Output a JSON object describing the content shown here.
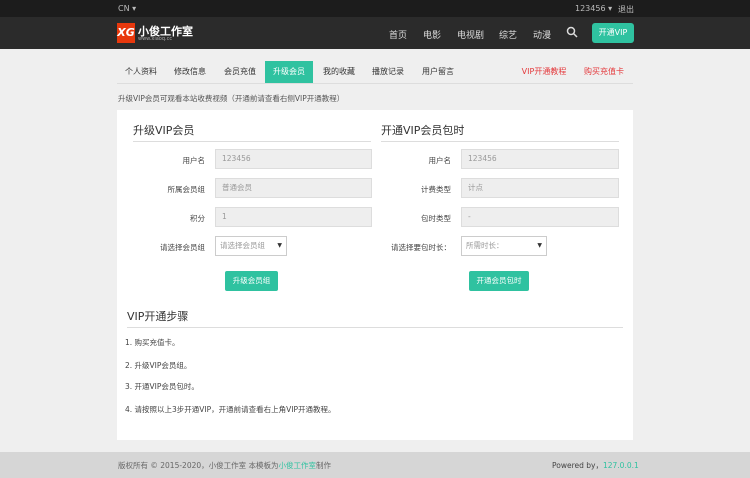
{
  "topbar": {
    "lang": "CN ▾",
    "user": "123456 ▾",
    "logout": "退出"
  },
  "logo": {
    "mark": "XG",
    "name": "小俊工作室",
    "url": "www.xiaoq.cc"
  },
  "nav": {
    "items": [
      "首页",
      "电影",
      "电视剧",
      "综艺",
      "动漫"
    ],
    "vip_button": "开通VIP"
  },
  "tabs": [
    "个人资料",
    "修改信息",
    "会员充值",
    "升级会员",
    "我的收藏",
    "播放记录",
    "用户留言"
  ],
  "tabs_right": [
    "VIP开通教程",
    "购买充值卡"
  ],
  "notice": "升级VIP会员可观看本站收费视频（开通前请查看右侧VIP开通教程）",
  "upgrade": {
    "title": "升级VIP会员",
    "username_label": "用户名",
    "username_value": "123456",
    "group_label": "所属会员组",
    "group_value": "普通会员",
    "points_label": "积分",
    "points_value": "1",
    "select_label": "请选择会员组",
    "select_value": "请选择会员组",
    "button": "升级会员组"
  },
  "package": {
    "title": "开通VIP会员包时",
    "username_label": "用户名",
    "username_value": "123456",
    "billing_label": "计费类型",
    "billing_value": "计点",
    "period_label": "包时类型",
    "period_value": "-",
    "select_label": "请选择要包时长：",
    "select_value": "所需时长：",
    "button": "开通会员包时"
  },
  "steps": {
    "title": "VIP开通步骤",
    "items": [
      "1. 购买充值卡。",
      "2. 升级VIP会员组。",
      "3. 开通VIP会员包时。",
      "4. 请按照以上3步开通VIP，开通前请查看右上角VIP开通教程。"
    ]
  },
  "footer": {
    "copy_prefix": "版权所有 © 2015-2020，小俊工作室 本模板为",
    "copy_link": "小俊工作室",
    "copy_suffix": "制作",
    "powered_prefix": "Powered by，",
    "powered_link": "127.0.0.1"
  }
}
